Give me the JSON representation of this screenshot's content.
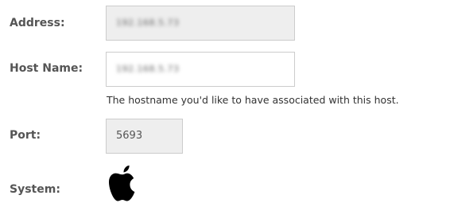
{
  "host_form": {
    "address": {
      "label": "Address:",
      "value": "192.168.5.73"
    },
    "host_name": {
      "label": "Host Name:",
      "value": "192.168.5.73",
      "help_text": "The hostname you'd like to have associated with this host."
    },
    "port": {
      "label": "Port:",
      "value": "5693"
    },
    "system": {
      "label": "System:",
      "icon": "apple-icon",
      "icon_color": "#000000"
    }
  }
}
